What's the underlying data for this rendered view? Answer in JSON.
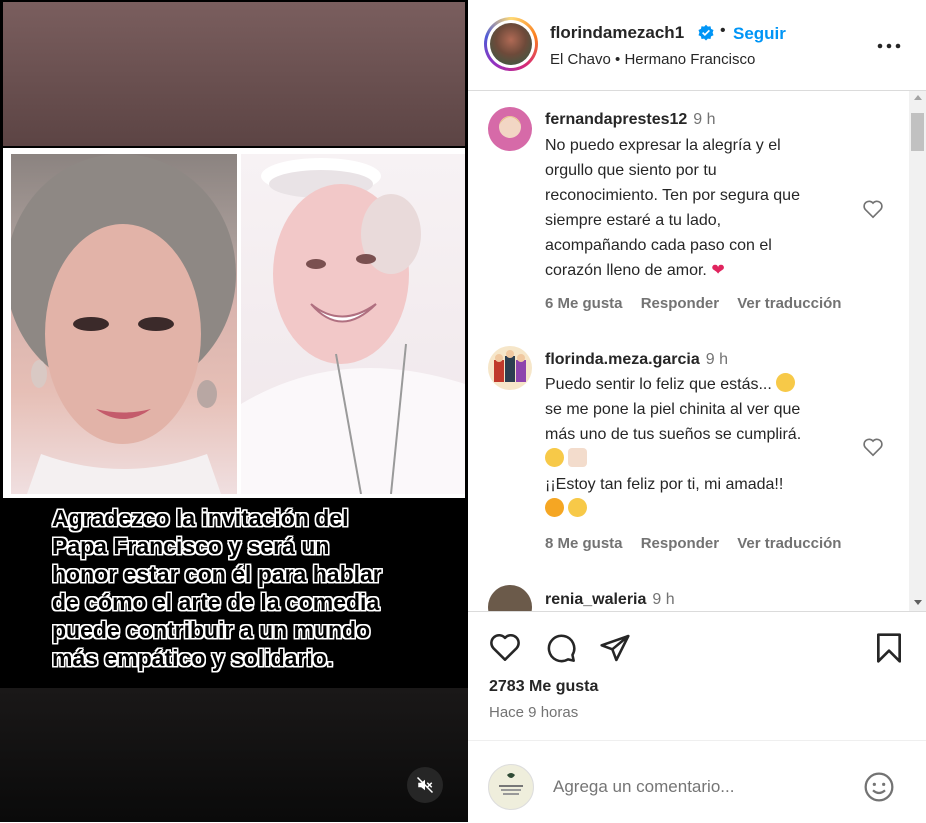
{
  "post": {
    "caption_lines": [
      "Agradezco la invitación del",
      "Papa Francisco y será un",
      "honor estar con él para hablar",
      "de cómo el arte de la comedia",
      "puede contribuir a un mundo",
      "más empático y solidario."
    ]
  },
  "header": {
    "username": "florindamezach1",
    "dot": "•",
    "follow_label": "Seguir",
    "subtitle": "El Chavo • Hermano Francisco"
  },
  "comments": [
    {
      "username": "fernandaprestes12",
      "time": "9 h",
      "lines": [
        "No puedo expresar la alegría y el",
        "orgullo que siento por tu",
        "reconocimiento. Ten por segura que",
        "siempre estaré a tu lado,",
        "acompañando cada paso con el",
        "corazón lleno de amor."
      ],
      "likes_label": "6 Me gusta",
      "reply_label": "Responder",
      "translate_label": "Ver traducción"
    },
    {
      "username": "florinda.meza.garcia",
      "time": "9 h",
      "lines": [
        "Puedo sentir lo feliz que estás...",
        "se me pone la piel chinita al ver que",
        "más uno de tus sueños se cumplirá.",
        "",
        "¡¡Estoy tan feliz por ti, mi amada!!",
        ""
      ],
      "likes_label": "8 Me gusta",
      "reply_label": "Responder",
      "translate_label": "Ver traducción"
    },
    {
      "username": "renia_waleria",
      "time": "9 h"
    }
  ],
  "footer": {
    "likes": "2783 Me gusta",
    "time_ago": "Hace 9 horas",
    "comment_placeholder": "Agrega un comentario..."
  },
  "colors": {
    "accent": "#0095f6",
    "text": "#262626",
    "muted": "#737373",
    "heart_emoji": "#e0245e"
  }
}
